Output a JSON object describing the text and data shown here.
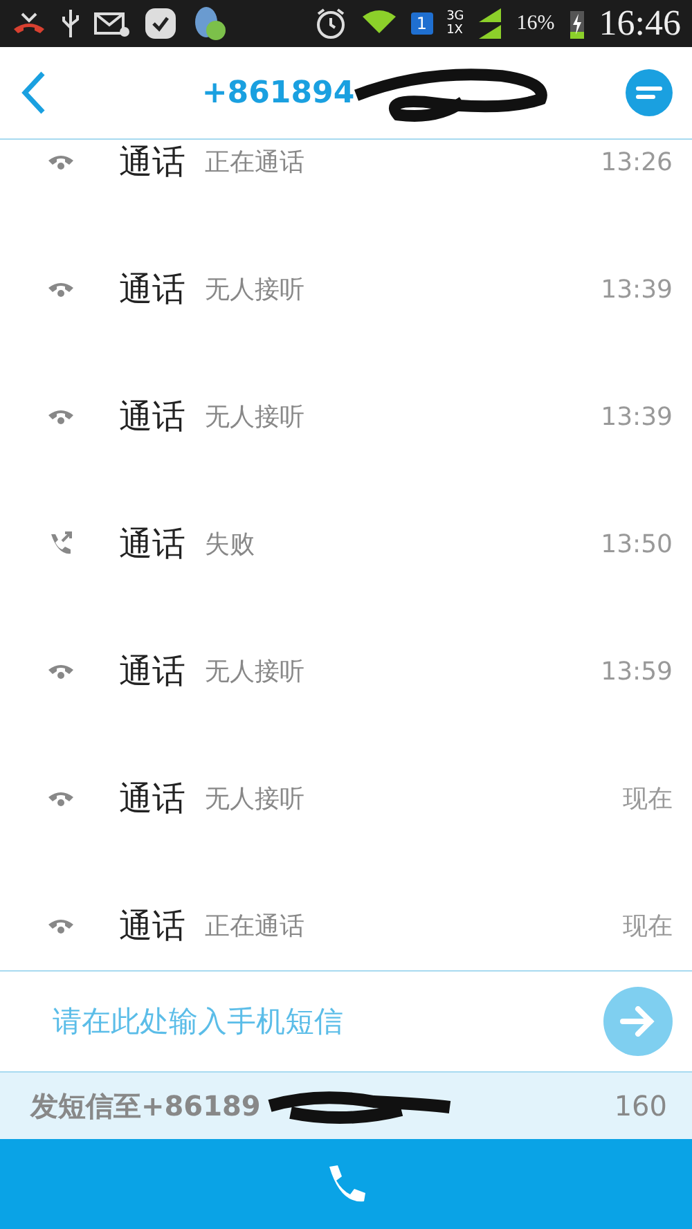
{
  "status_bar": {
    "sim": "1",
    "network_top": "3G",
    "network_bottom": "1X",
    "battery": "16%",
    "time": "16:46"
  },
  "header": {
    "title": "+861894"
  },
  "calls": [
    {
      "kind": "hangup",
      "label": "通话",
      "status": "正在通话",
      "time": "13:26"
    },
    {
      "kind": "hangup",
      "label": "通话",
      "status": "无人接听",
      "time": "13:39"
    },
    {
      "kind": "hangup",
      "label": "通话",
      "status": "无人接听",
      "time": "13:39"
    },
    {
      "kind": "outgoing",
      "label": "通话",
      "status": "失败",
      "time": "13:50"
    },
    {
      "kind": "hangup",
      "label": "通话",
      "status": "无人接听",
      "time": "13:59"
    },
    {
      "kind": "hangup",
      "label": "通话",
      "status": "无人接听",
      "time": "现在"
    },
    {
      "kind": "hangup",
      "label": "通话",
      "status": "正在通话",
      "time": "现在"
    }
  ],
  "composer": {
    "placeholder": "请在此处输入手机短信"
  },
  "send_info": {
    "recipient": "发短信至+86189",
    "counter": "160"
  }
}
